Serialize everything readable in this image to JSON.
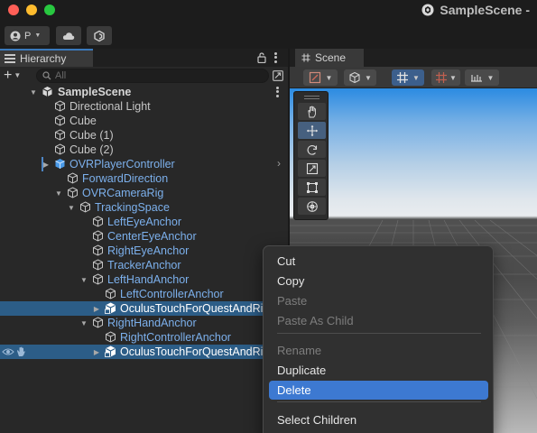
{
  "window": {
    "scene_title": "SampleScene - "
  },
  "toolbar": {
    "account_label": "P",
    "icons": [
      "account-icon",
      "cloud-icon",
      "collab-icon"
    ]
  },
  "hierarchy": {
    "tab_label": "Hierarchy",
    "search_placeholder": "All",
    "rows": [
      {
        "label": "SampleScene",
        "style": "scene"
      },
      {
        "label": "Directional Light",
        "style": "normal"
      },
      {
        "label": "Cube",
        "style": "normal"
      },
      {
        "label": "Cube (1)",
        "style": "normal"
      },
      {
        "label": "Cube (2)",
        "style": "normal"
      },
      {
        "label": "OVRPlayerController",
        "style": "prefab"
      },
      {
        "label": "ForwardDirection",
        "style": "prefab"
      },
      {
        "label": "OVRCameraRig",
        "style": "prefab"
      },
      {
        "label": "TrackingSpace",
        "style": "prefab"
      },
      {
        "label": "LeftEyeAnchor",
        "style": "prefab"
      },
      {
        "label": "CenterEyeAnchor",
        "style": "prefab"
      },
      {
        "label": "RightEyeAnchor",
        "style": "prefab"
      },
      {
        "label": "TrackerAnchor",
        "style": "prefab"
      },
      {
        "label": "LeftHandAnchor",
        "style": "prefab"
      },
      {
        "label": "LeftControllerAnchor",
        "style": "prefab"
      },
      {
        "label": "OculusTouchForQuestAndRi",
        "style": "selected"
      },
      {
        "label": "RightHandAnchor",
        "style": "prefab"
      },
      {
        "label": "RightControllerAnchor",
        "style": "prefab"
      },
      {
        "label": "OculusTouchForQuestAndRi",
        "style": "selected"
      }
    ]
  },
  "scene": {
    "tab_label": "Scene",
    "tools": [
      "view-tool",
      "move-tool",
      "rotate-tool",
      "scale-tool",
      "rect-tool",
      "transform-tool"
    ],
    "active_tool": "move-tool"
  },
  "context_menu": {
    "items": [
      {
        "label": "Cut",
        "enabled": true
      },
      {
        "label": "Copy",
        "enabled": true
      },
      {
        "label": "Paste",
        "enabled": false
      },
      {
        "label": "Paste As Child",
        "enabled": false
      },
      {
        "label": "Rename",
        "enabled": false
      },
      {
        "label": "Duplicate",
        "enabled": true
      },
      {
        "label": "Delete",
        "enabled": true,
        "highlighted": true
      },
      {
        "label": "Select Children",
        "enabled": true
      }
    ]
  }
}
